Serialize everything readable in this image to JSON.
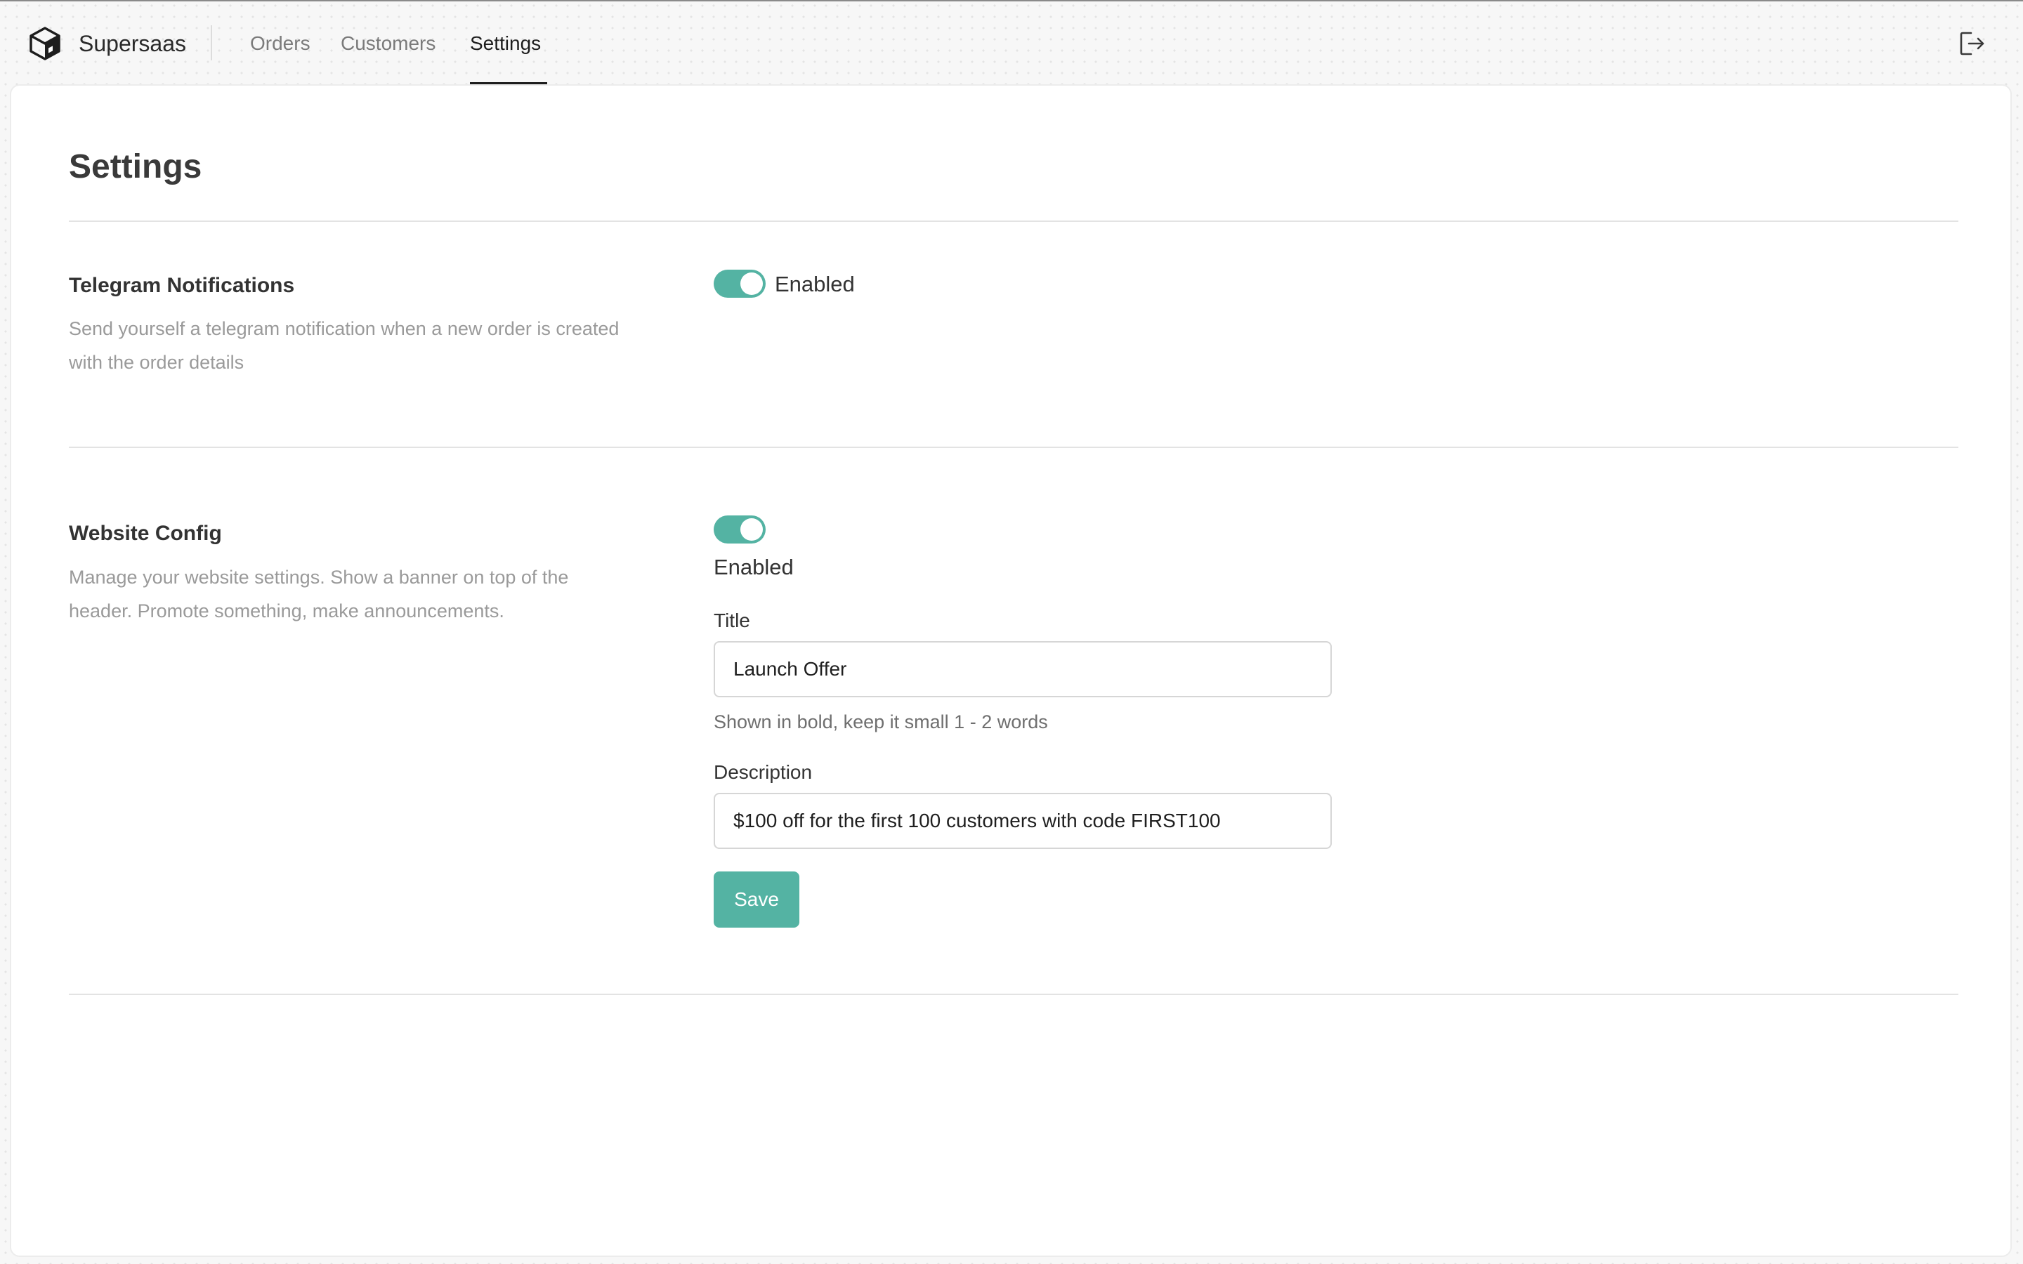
{
  "header": {
    "brand": "Supersaas",
    "nav": [
      {
        "label": "Orders",
        "active": false
      },
      {
        "label": "Customers",
        "active": false
      },
      {
        "label": "Settings",
        "active": true
      }
    ],
    "logo_icon": "cube-icon",
    "logout_icon": "logout-icon"
  },
  "page": {
    "title": "Settings"
  },
  "telegram": {
    "title": "Telegram Notifications",
    "description": "Send yourself a telegram notification when a new order is created with the order details",
    "toggle_on": true,
    "toggle_label": "Enabled"
  },
  "website": {
    "title": "Website Config",
    "description": "Manage your website settings. Show a banner on top of the header. Promote something, make announcements.",
    "toggle_on": true,
    "toggle_label": "Enabled",
    "title_field": {
      "label": "Title",
      "value": "Launch Offer",
      "hint": "Shown in bold, keep it small 1 - 2 words"
    },
    "description_field": {
      "label": "Description",
      "value": "$100 off for the first 100 customers with code FIRST100"
    },
    "save_label": "Save"
  },
  "colors": {
    "accent": "#54b3a3",
    "text": "#2f2f2f",
    "muted": "#9a9a9a",
    "background": "#f7f7f7"
  }
}
